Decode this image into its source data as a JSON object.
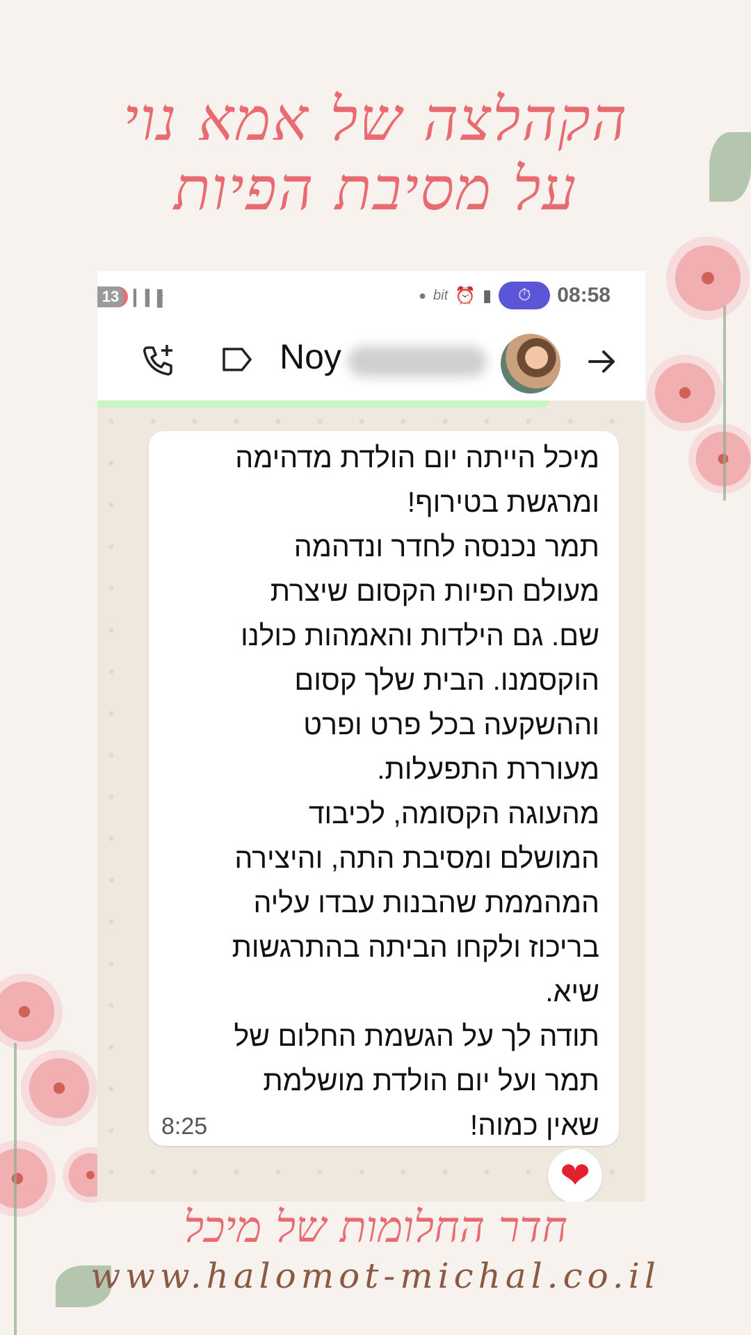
{
  "headline": {
    "line1": "הקהלצה של אמא נוי",
    "line2": "על מסיבת הפיות"
  },
  "status_bar": {
    "notification_count": "13",
    "extra_icon_text": "bit",
    "time": "08:58"
  },
  "chat_header": {
    "contact_name": "Noy"
  },
  "message": {
    "lines": [
      "מיכל הייתה יום הולדת מדהימה",
      "ומרגשת בטירוף!",
      "תמר נכנסה לחדר ונדהמה",
      "מעולם הפיות הקסום שיצרת",
      "שם. גם הילדות והאמהות כולנו",
      "הוקסמנו. הבית שלך קסום",
      "וההשקעה בכל פרט ופרט",
      "מעוררת התפעלות.",
      "מהעוגה הקסומה, לכיבוד",
      "המושלם ומסיבת התה, והיצירה",
      "המהממת שהבנות עבדו עליה",
      "בריכוז ולקחו הביתה בהתרגשות",
      "שיא.",
      "תודה לך על הגשמת החלום של",
      "תמר ועל יום הולדת מושלמת",
      "שאין כמוה!"
    ],
    "time": "8:25",
    "reaction": "❤"
  },
  "footer": {
    "title": "חדר החלומות של מיכל",
    "url": "www.halomot-michal.co.il"
  },
  "colors": {
    "headline": "#e96b72",
    "timer_pill": "#5b55d8",
    "footer_url": "#8a5a44",
    "reaction": "#e3202e"
  },
  "icons": [
    "call-add-icon",
    "label-icon",
    "back-arrow-icon",
    "timer-icon",
    "alarm-icon",
    "battery-icon",
    "signal-icon",
    "wifi-icon",
    "heart-icon"
  ]
}
